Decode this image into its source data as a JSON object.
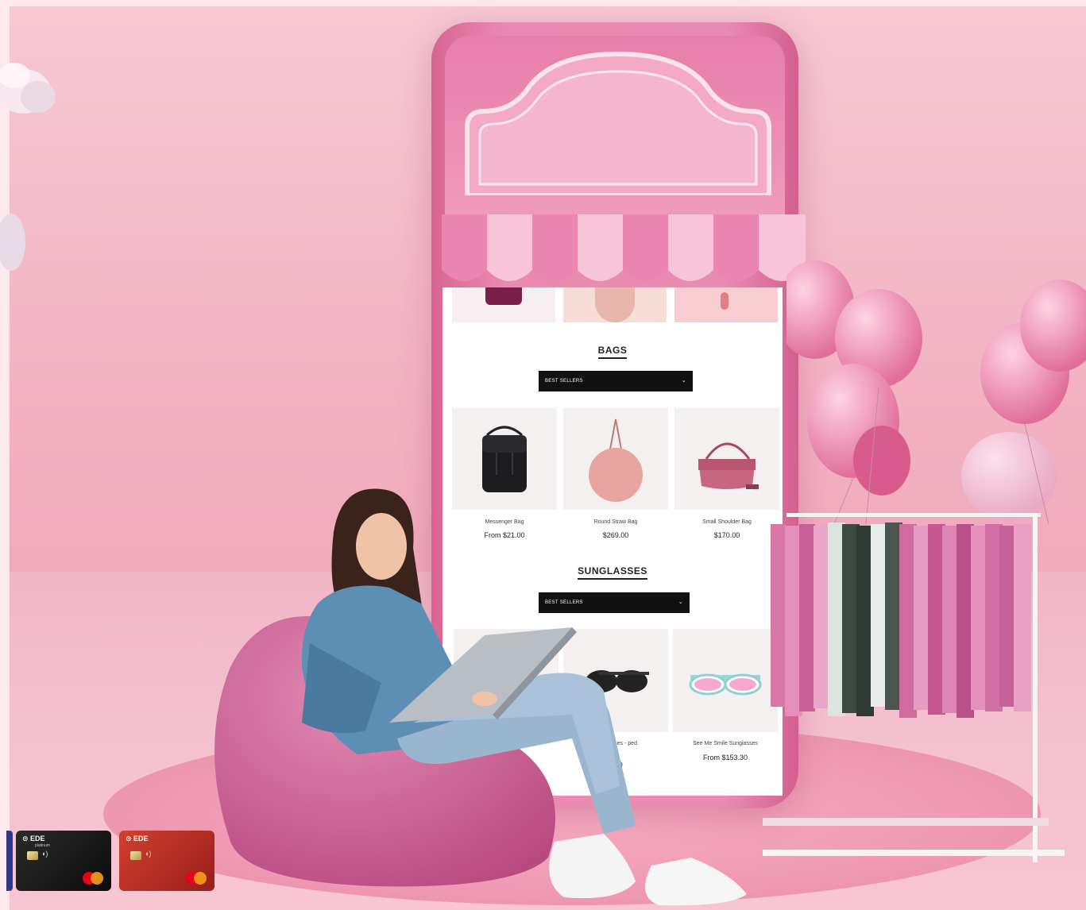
{
  "scene": {
    "description_colors": {
      "background": "#f4bfcb",
      "phone": "#e98cb1",
      "accent": "#d45f8f"
    }
  },
  "storefront": {
    "sections": [
      {
        "title": "BAGS",
        "sort_label": "BEST SELLERS",
        "products": [
          {
            "name": "Messenger Bag",
            "price": "From $21.00"
          },
          {
            "name": "Round Straw Bag",
            "price": "$269.00"
          },
          {
            "name": "Small Shoulder Bag",
            "price": "$170.00"
          }
        ]
      },
      {
        "title": "SUNGLASSES",
        "sort_label": "BEST SELLERS",
        "products": [
          {
            "name": "",
            "price": ""
          },
          {
            "name": "Sunglasses - ped",
            "price": "9.00"
          },
          {
            "name": "See Me Smile Sunglasses",
            "price": "From $153.30"
          }
        ]
      }
    ]
  },
  "cards": [
    {
      "brand": "EDE",
      "tier": "platinum"
    },
    {
      "brand": "EDE",
      "tier": ""
    }
  ],
  "icons": [
    "chevron-down-icon",
    "mastercard-logo",
    "contactless-icon",
    "chip-icon"
  ]
}
